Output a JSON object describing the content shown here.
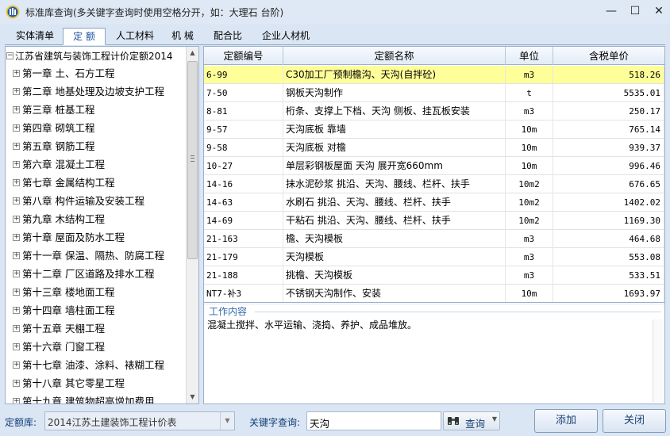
{
  "window": {
    "title": "标准库查询(多关键字查询时使用空格分开，如：大理石 台阶)",
    "controls": {
      "minimize": "—",
      "maximize": "☐",
      "close": "✕"
    }
  },
  "tabs": [
    {
      "label": "实体清单",
      "active": false
    },
    {
      "label": "定 额",
      "active": true
    },
    {
      "label": "人工材料",
      "active": false
    },
    {
      "label": "机 械",
      "active": false
    },
    {
      "label": "配合比",
      "active": false
    },
    {
      "label": "企业人材机",
      "active": false
    }
  ],
  "tree": {
    "root_label": "江苏省建筑与装饰工程计价定额2014",
    "items": [
      "第一章  土、石方工程",
      "第二章  地基处理及边坡支护工程",
      "第三章  桩基工程",
      "第四章  砌筑工程",
      "第五章  钢筋工程",
      "第六章  混凝土工程",
      "第七章  金属结构工程",
      "第八章     构件运输及安装工程",
      "第九章     木结构工程",
      "第十章  屋面及防水工程",
      "第十一章  保温、隔热、防腐工程",
      "第十二章  厂区道路及排水工程",
      "第十三章  楼地面工程",
      "第十四章  墙柱面工程",
      "第十五章  天棚工程",
      "第十六章  门窗工程",
      "第十七章  油漆、涂料、裱糊工程",
      "第十八章  其它零星工程",
      "第十九章  建筑物超高增加费用"
    ]
  },
  "grid": {
    "headers": {
      "code": "定额编号",
      "name": "定额名称",
      "unit": "单位",
      "price": "含税单价"
    },
    "rows": [
      {
        "code": "6-99",
        "name": "C30加工厂预制檐沟、天沟(自拌砼)",
        "unit": "m3",
        "price": "518.26",
        "selected": true
      },
      {
        "code": "7-50",
        "name": "钢板天沟制作",
        "unit": "t",
        "price": "5535.01"
      },
      {
        "code": "8-81",
        "name": "桁条、支撑上下档、天沟 侧板、挂瓦板安装",
        "unit": "m3",
        "price": "250.17"
      },
      {
        "code": "9-57",
        "name": "天沟底板 靠墙",
        "unit": "10m",
        "price": "765.14"
      },
      {
        "code": "9-58",
        "name": "天沟底板 对檐",
        "unit": "10m",
        "price": "939.37"
      },
      {
        "code": "10-27",
        "name": "单层彩钢板屋面 天沟 展开宽660mm",
        "unit": "10m",
        "price": "996.46"
      },
      {
        "code": "14-16",
        "name": "抹水泥砂浆 挑沿、天沟、腰线、栏杆、扶手",
        "unit": "10m2",
        "price": "676.65"
      },
      {
        "code": "14-63",
        "name": "水刷石 挑沿、天沟、腰线、栏杆、扶手",
        "unit": "10m2",
        "price": "1402.02"
      },
      {
        "code": "14-69",
        "name": "干粘石 挑沿、天沟、腰线、栏杆、扶手",
        "unit": "10m2",
        "price": "1169.30"
      },
      {
        "code": "21-163",
        "name": "檐、天沟模板",
        "unit": "m3",
        "price": "464.68"
      },
      {
        "code": "21-179",
        "name": "天沟模板",
        "unit": "m3",
        "price": "553.08"
      },
      {
        "code": "21-188",
        "name": "挑檐、天沟模板",
        "unit": "m3",
        "price": "533.51"
      },
      {
        "code": "NT7-补3",
        "name": "不锈钢天沟制作、安装",
        "unit": "10m",
        "price": "1693.97"
      }
    ]
  },
  "work_content": {
    "title": "工作内容",
    "text": "混凝土搅拌、水平运输、浇捣、养护、成品堆放。"
  },
  "bottom": {
    "library_label": "定额库:",
    "library_value": "2014江苏土建装饰工程计价表",
    "keyword_label": "关键字查询:",
    "keyword_value": "天沟",
    "search_label": "查询",
    "add_label": "添加",
    "close_label": "关闭"
  },
  "colors": {
    "selected_row": "#ffff99",
    "accent": "#1a4f9c"
  }
}
